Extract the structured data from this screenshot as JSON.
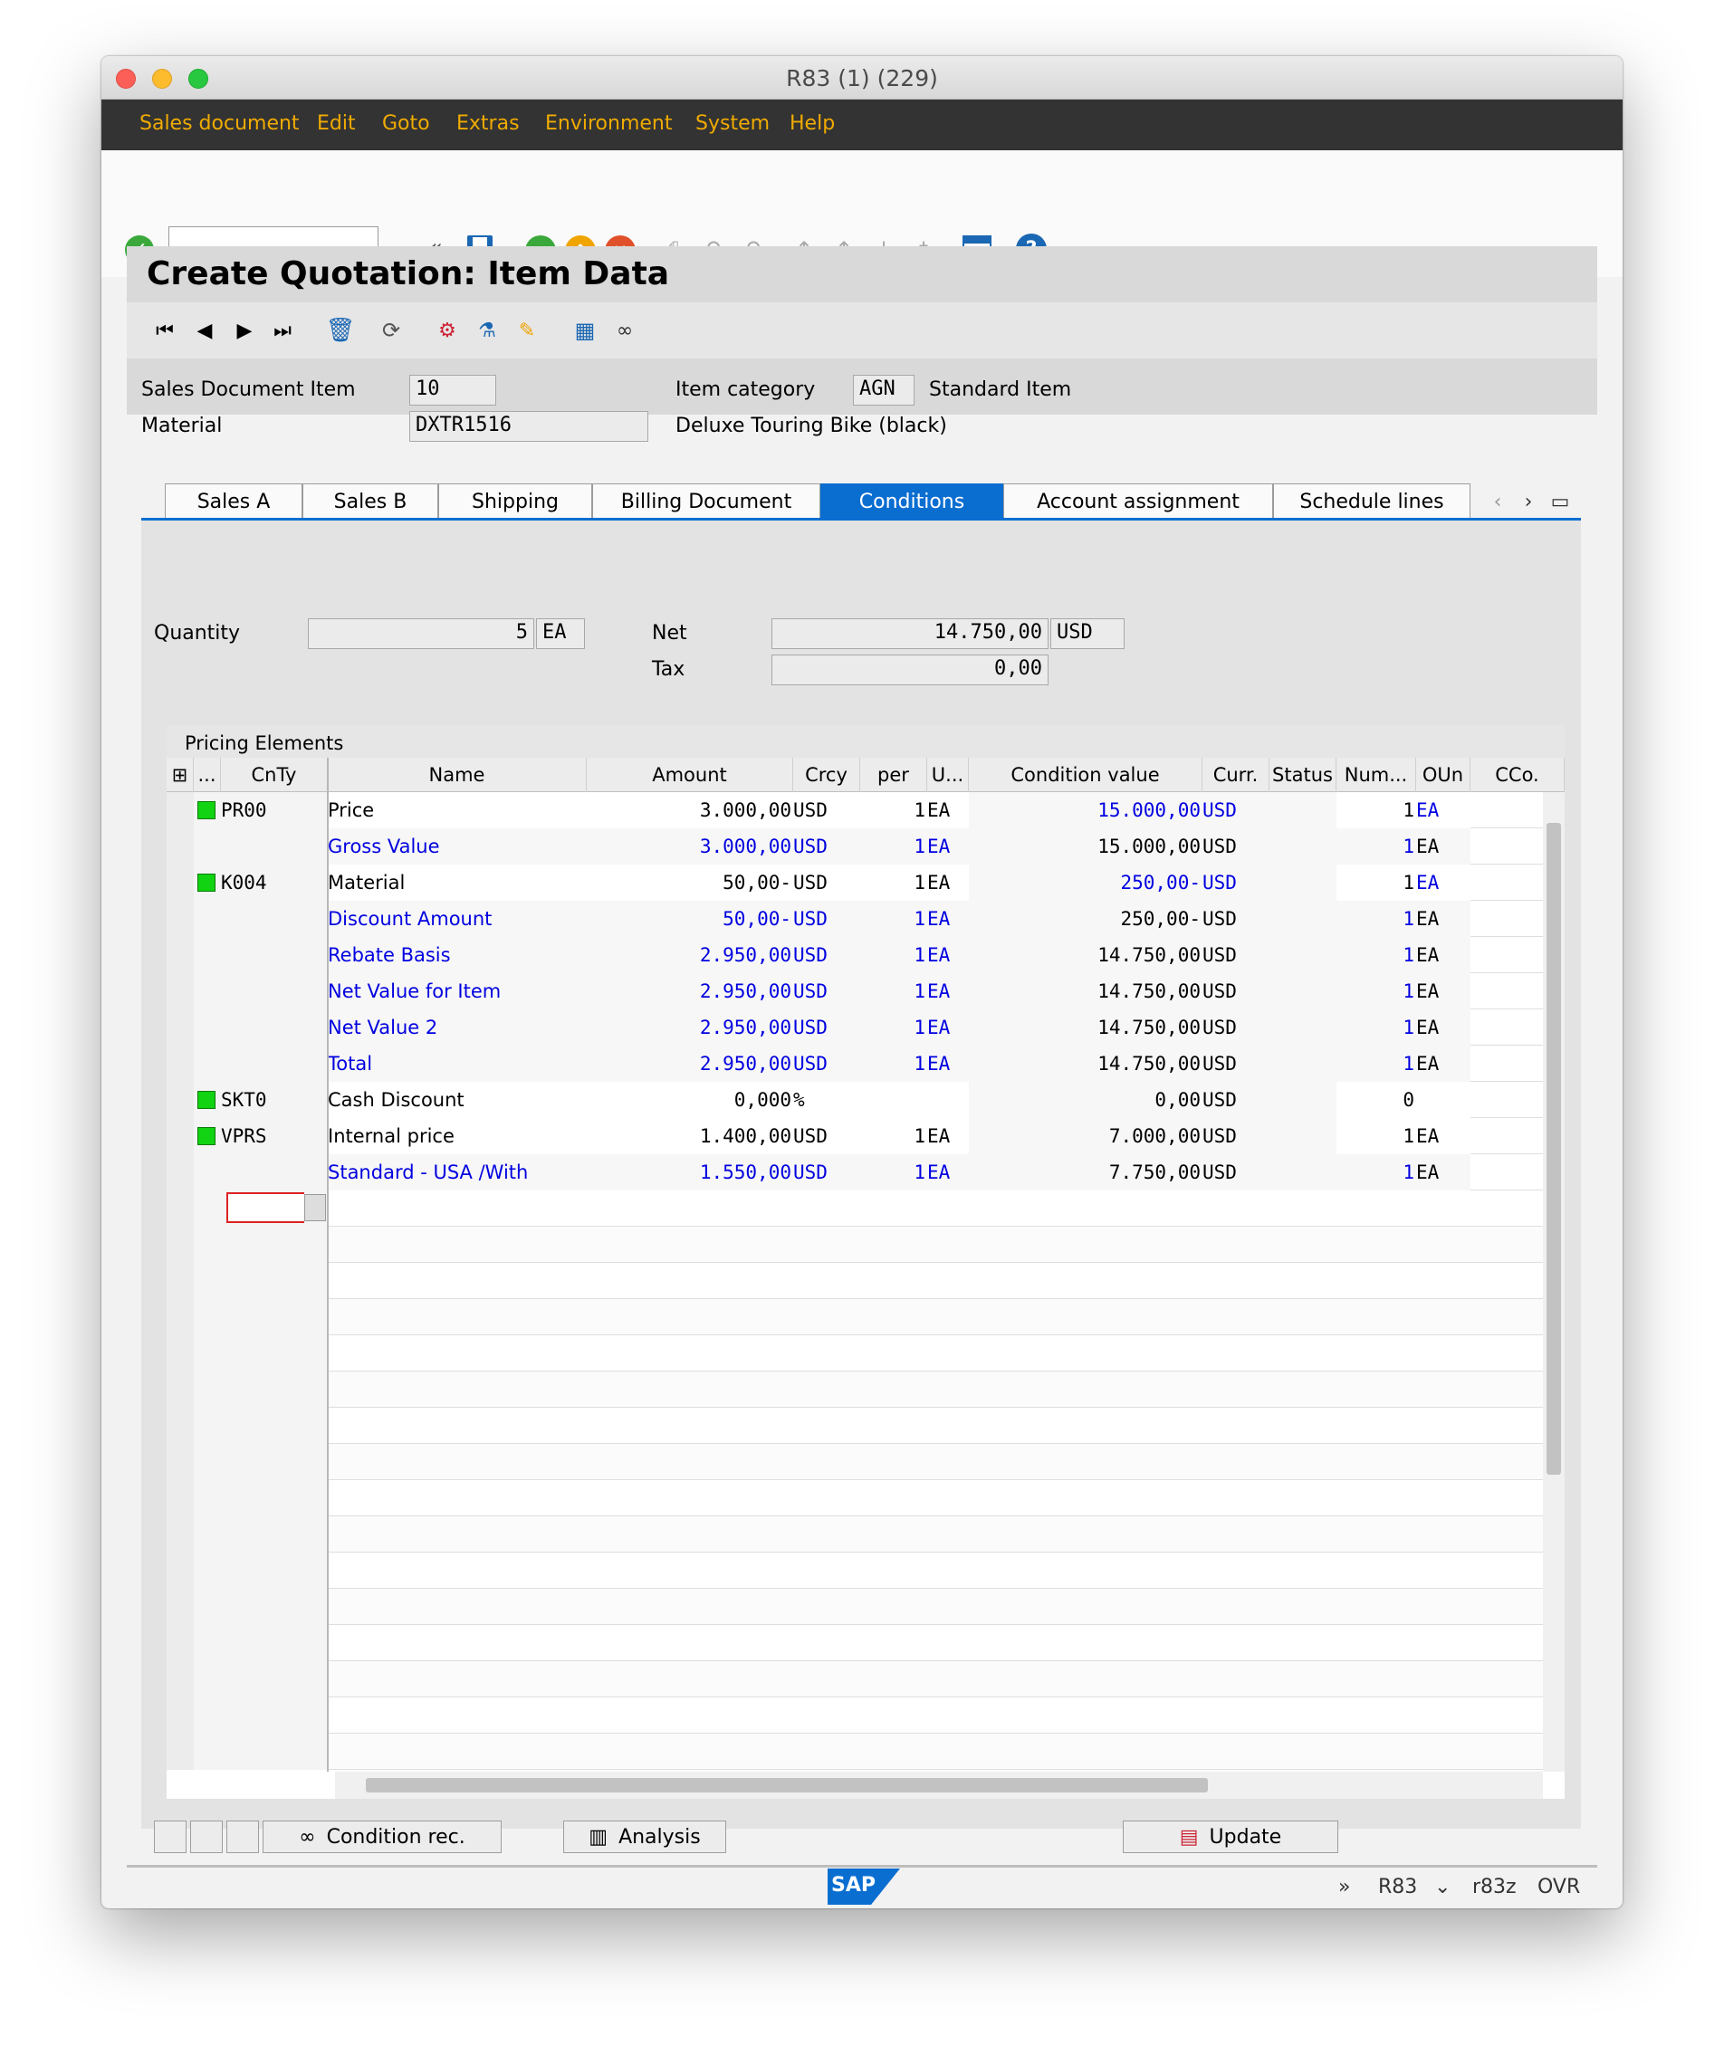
{
  "window": {
    "title": "R83 (1) (229)"
  },
  "menu": [
    "Sales document",
    "Edit",
    "Goto",
    "Extras",
    "Environment",
    "System",
    "Help"
  ],
  "page": {
    "title": "Create Quotation: Item Data"
  },
  "header": {
    "item_label": "Sales Document Item",
    "item_value": "10",
    "material_label": "Material",
    "material_value": "DXTR1516",
    "itemcat_label": "Item category",
    "itemcat_value": "AGN",
    "itemcat_text": "Standard Item",
    "material_desc": "Deluxe Touring Bike (black)"
  },
  "tabs": [
    "Sales A",
    "Sales B",
    "Shipping",
    "Billing Document",
    "Conditions",
    "Account assignment",
    "Schedule lines"
  ],
  "active_tab": "Conditions",
  "conditions": {
    "qty_label": "Quantity",
    "qty_value": "5",
    "qty_unit": "EA",
    "net_label": "Net",
    "net_value": "14.750,00",
    "net_curr": "USD",
    "tax_label": "Tax",
    "tax_value": "0,00"
  },
  "pricing": {
    "caption": "Pricing Elements",
    "columns": [
      "...",
      "CnTy",
      "Name",
      "Amount",
      "Crcy",
      "per",
      "U...",
      "Condition value",
      "Curr.",
      "Status",
      "Num...",
      "OUn",
      "CCo."
    ],
    "rows": [
      {
        "lamp": true,
        "cnty": "PR00",
        "name": "Price",
        "amount": "3.000,00",
        "crcy": "USD",
        "per": "1",
        "uom": "EA",
        "condval": "15.000,00",
        "curr": "USD",
        "num": "1",
        "oun": "EA",
        "style": "main"
      },
      {
        "lamp": false,
        "cnty": "",
        "name": "Gross Value",
        "amount": "3.000,00",
        "crcy": "USD",
        "per": "1",
        "uom": "EA",
        "condval": "15.000,00",
        "curr": "USD",
        "num": "1",
        "oun": "EA",
        "style": "sub"
      },
      {
        "lamp": true,
        "cnty": "K004",
        "name": "Material",
        "amount": "50,00-",
        "crcy": "USD",
        "per": "1",
        "uom": "EA",
        "condval": "250,00-",
        "curr": "USD",
        "num": "1",
        "oun": "EA",
        "style": "main"
      },
      {
        "lamp": false,
        "cnty": "",
        "name": "Discount Amount",
        "amount": "50,00-",
        "crcy": "USD",
        "per": "1",
        "uom": "EA",
        "condval": "250,00-",
        "curr": "USD",
        "num": "1",
        "oun": "EA",
        "style": "sub"
      },
      {
        "lamp": false,
        "cnty": "",
        "name": "Rebate Basis",
        "amount": "2.950,00",
        "crcy": "USD",
        "per": "1",
        "uom": "EA",
        "condval": "14.750,00",
        "curr": "USD",
        "num": "1",
        "oun": "EA",
        "style": "sub"
      },
      {
        "lamp": false,
        "cnty": "",
        "name": "Net Value for Item",
        "amount": "2.950,00",
        "crcy": "USD",
        "per": "1",
        "uom": "EA",
        "condval": "14.750,00",
        "curr": "USD",
        "num": "1",
        "oun": "EA",
        "style": "sub"
      },
      {
        "lamp": false,
        "cnty": "",
        "name": "Net Value 2",
        "amount": "2.950,00",
        "crcy": "USD",
        "per": "1",
        "uom": "EA",
        "condval": "14.750,00",
        "curr": "USD",
        "num": "1",
        "oun": "EA",
        "style": "sub"
      },
      {
        "lamp": false,
        "cnty": "",
        "name": "Total",
        "amount": "2.950,00",
        "crcy": "USD",
        "per": "1",
        "uom": "EA",
        "condval": "14.750,00",
        "curr": "USD",
        "num": "1",
        "oun": "EA",
        "style": "sub"
      },
      {
        "lamp": true,
        "cnty": "SKT0",
        "name": "Cash Discount",
        "amount": "0,000",
        "crcy": "%",
        "per": "",
        "uom": "",
        "condval": "0,00",
        "curr": "USD",
        "num": "0",
        "oun": "",
        "style": "main"
      },
      {
        "lamp": true,
        "cnty": "VPRS",
        "name": "Internal price",
        "amount": "1.400,00",
        "crcy": "USD",
        "per": "1",
        "uom": "EA",
        "condval": "7.000,00",
        "curr": "USD",
        "num": "1",
        "oun": "EA",
        "style": "main"
      },
      {
        "lamp": false,
        "cnty": "",
        "name": "Standard - USA /With",
        "amount": "1.550,00",
        "crcy": "USD",
        "per": "1",
        "uom": "EA",
        "condval": "7.750,00",
        "curr": "USD",
        "num": "1",
        "oun": "EA",
        "style": "subb"
      }
    ]
  },
  "buttons": {
    "condition_rec": "Condition rec.",
    "analysis": "Analysis",
    "update": "Update"
  },
  "status": {
    "system": "R83",
    "client": "r83z",
    "mode": "OVR",
    "logo": "SAP"
  },
  "colors": {
    "accent": "#0a6ed1",
    "menu_text": "#f0ab00",
    "link": "#0000e0",
    "lamp": "#11d311"
  }
}
